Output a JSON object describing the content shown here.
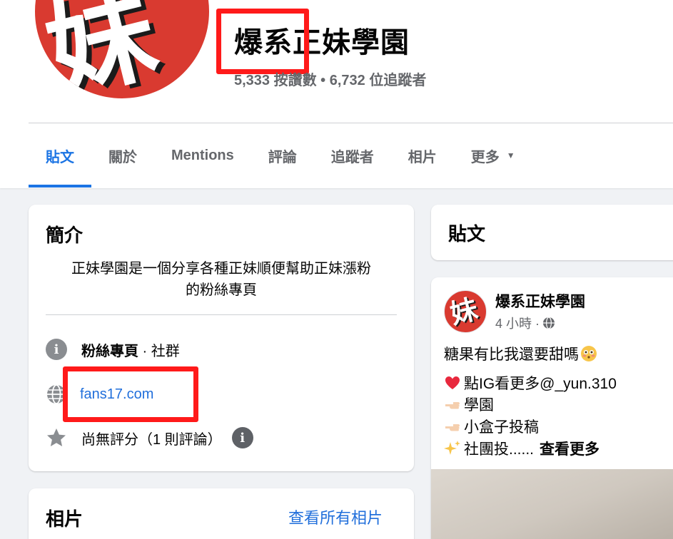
{
  "page": {
    "name": "爆系正妹學園",
    "stats": "5,333 按讚數 • 6,732 位追蹤者"
  },
  "tabs": [
    {
      "label": "貼文",
      "active": true
    },
    {
      "label": "關於"
    },
    {
      "label": "Mentions"
    },
    {
      "label": "評論"
    },
    {
      "label": "追蹤者"
    },
    {
      "label": "相片"
    },
    {
      "label": "更多"
    }
  ],
  "intro": {
    "title": "簡介",
    "description_line1": "正妹學園是一個分享各種正妹順便幫助正妹漲粉",
    "description_line2": "的粉絲專頁",
    "category_bold": "粉絲專頁",
    "category_rest": " · 社群",
    "website": "fans17.com",
    "rating": "尚無評分（1 則評論）"
  },
  "photos": {
    "title": "相片",
    "see_all": "查看所有相片"
  },
  "posts_section": {
    "title": "貼文"
  },
  "post": {
    "author": "爆系正妹學園",
    "time": "4 小時 · ",
    "line1": "糖果有比我還要甜嗎",
    "line2": "點IG看更多@_yun.310",
    "line3": "學園",
    "line4": "小盒子投稿",
    "line5": "社團投......",
    "see_more": "查看更多"
  },
  "avatar_glyph": "妹",
  "colors": {
    "accent": "#1b74e4",
    "link": "#216fdb",
    "avatar_red": "#d93a30",
    "highlight_red": "#ff1a1a"
  }
}
